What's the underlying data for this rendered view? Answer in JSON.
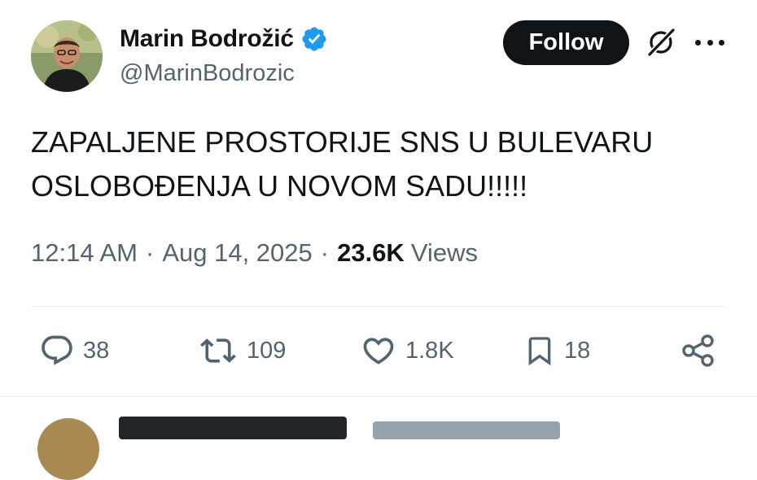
{
  "tweet": {
    "author": {
      "name": "Marin Bodrožić",
      "handle": "@MarinBodrozic",
      "verified": true,
      "verified_color": "#1d9bf0"
    },
    "follow_label": "Follow",
    "text_lines": [
      "ZAPALJENE PROSTORIJE SNS U BULEVARU",
      "OSLOBOĐENJA U NOVOM SADU!!!!!"
    ],
    "time": "12:14 AM",
    "separator": "·",
    "date": "Aug 14, 2025",
    "views_count": "23.6K",
    "views_label": "Views",
    "actions": {
      "reply": {
        "icon": "reply-icon",
        "count": "38"
      },
      "retweet": {
        "icon": "retweet-icon",
        "count": "109"
      },
      "like": {
        "icon": "heart-icon",
        "count": "1.8K"
      },
      "bookmark": {
        "icon": "bookmark-icon",
        "count": "18"
      },
      "share": {
        "icon": "share-icon"
      }
    },
    "header_icons": [
      "grok-icon",
      "more-icon"
    ]
  },
  "colors": {
    "text_primary": "#0f1419",
    "text_secondary": "#536471",
    "divider": "#eff3f4",
    "follow_bg": "#0f1419"
  }
}
